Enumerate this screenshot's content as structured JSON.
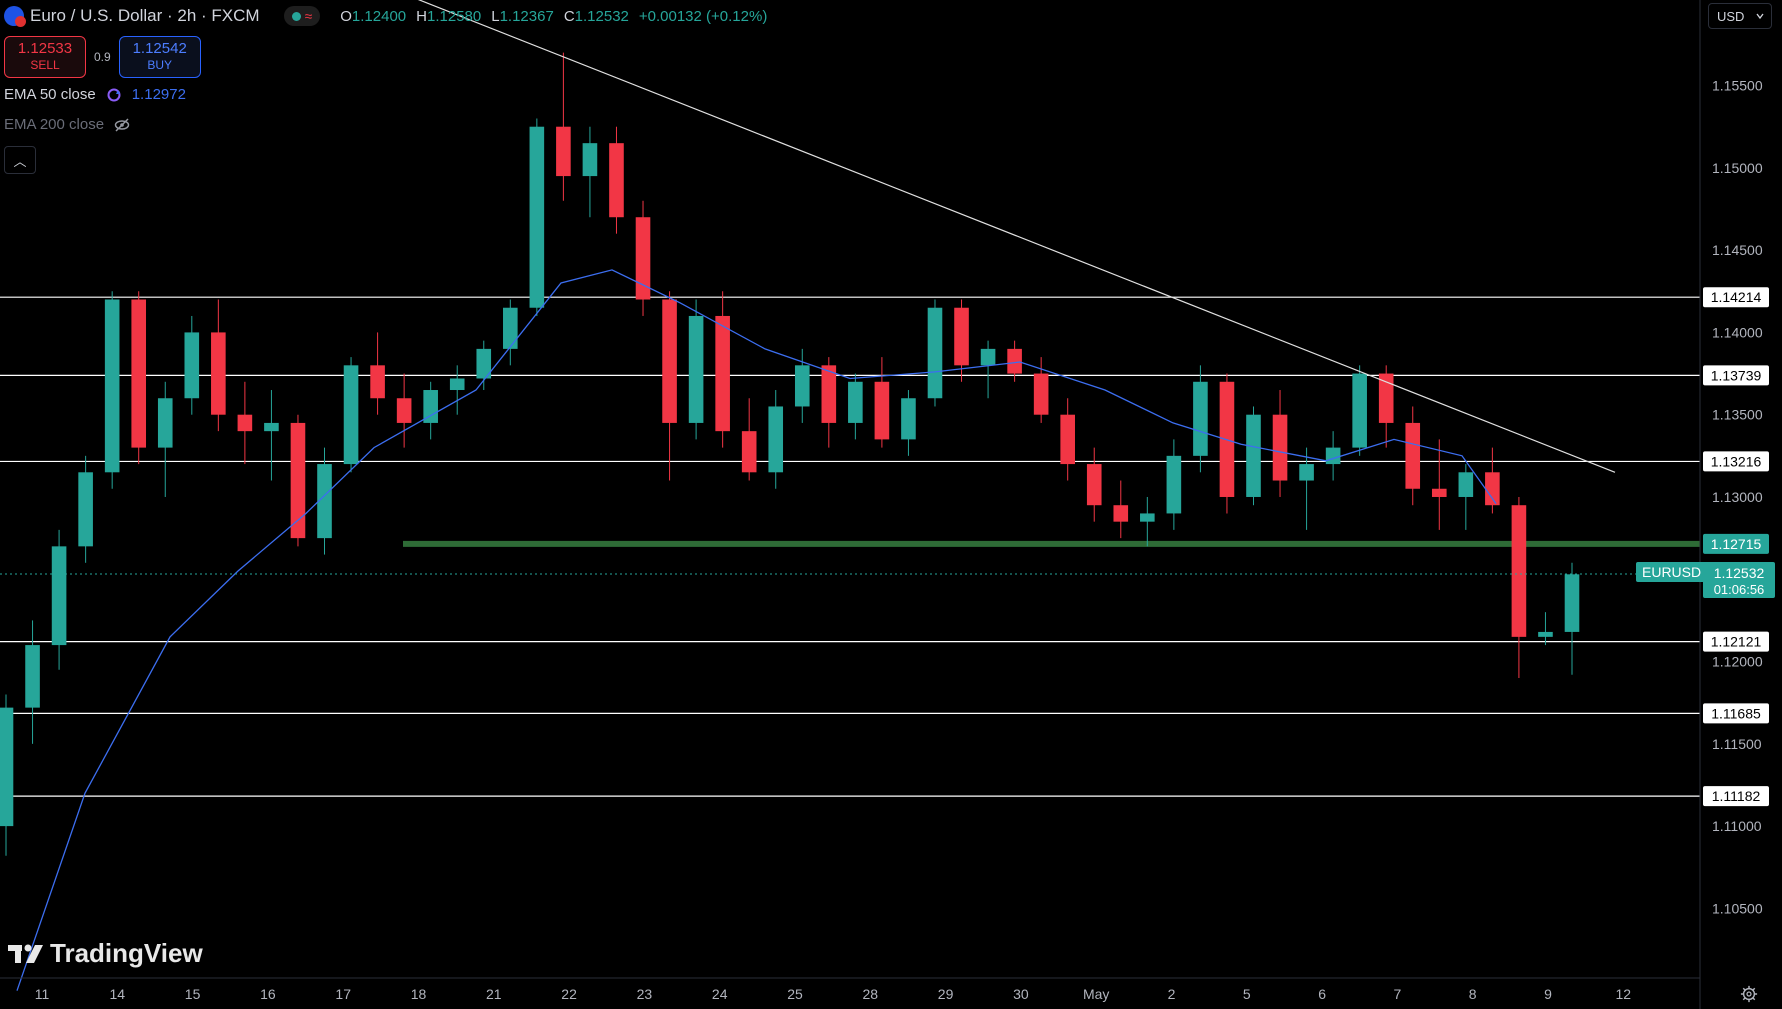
{
  "header": {
    "symbol_title": "Euro / U.S. Dollar · 2h · FXCM",
    "ohlc": {
      "o_label": "O",
      "o": "1.12400",
      "h_label": "H",
      "h": "1.12580",
      "l_label": "L",
      "l": "1.12367",
      "c_label": "C",
      "c": "1.12532",
      "change": "+0.00132 (+0.12%)"
    }
  },
  "trade": {
    "sell_price": "1.12533",
    "sell_label": "SELL",
    "spread": "0.9",
    "buy_price": "1.12542",
    "buy_label": "BUY"
  },
  "indicators": [
    {
      "label": "EMA 50 close",
      "value": "1.12972",
      "color": "#3c6ef0",
      "visible": true
    },
    {
      "label": "EMA 200 close",
      "visible": false
    }
  ],
  "currency": "USD",
  "brand": "TradingView",
  "icons": [
    "refresh-icon",
    "eye-off-icon",
    "chevron-up-icon",
    "chevron-down-icon",
    "gear-icon",
    "flag-icon"
  ],
  "colors": {
    "background": "#000000",
    "up": "#26a69a",
    "down": "#f23645",
    "ema": "#3c6ef0",
    "level": "#ffffff",
    "zone": "#2e6b36"
  },
  "chart_data": {
    "type": "candlestick",
    "x_tick_labels": [
      "11",
      "14",
      "15",
      "16",
      "17",
      "18",
      "21",
      "22",
      "23",
      "24",
      "25",
      "28",
      "29",
      "30",
      "May",
      "2",
      "5",
      "6",
      "7",
      "8",
      "9",
      "12"
    ],
    "y_tick_labels": [
      "1.10500",
      "1.11000",
      "1.11500",
      "1.12000",
      "1.12500",
      "1.13000",
      "1.13500",
      "1.14000",
      "1.14500",
      "1.15000",
      "1.15500"
    ],
    "y_range": [
      1.10077,
      1.1602
    ],
    "horizontal_levels": [
      "1.14214",
      "1.13739",
      "1.13216",
      "1.12121",
      "1.11685",
      "1.11182"
    ],
    "support_zone": "1.12715",
    "trendline": {
      "from": [
        0.21,
        1.1617
      ],
      "to": [
        0.95,
        1.1315
      ]
    },
    "last_price": {
      "symbol": "EURUSD",
      "price": "1.12532",
      "countdown": "01:06:56"
    },
    "ema50_key": [
      [
        0.01,
        1.1
      ],
      [
        0.05,
        1.112
      ],
      [
        0.1,
        1.1215
      ],
      [
        0.14,
        1.1255
      ],
      [
        0.18,
        1.129
      ],
      [
        0.22,
        1.133
      ],
      [
        0.28,
        1.1365
      ],
      [
        0.33,
        1.143
      ],
      [
        0.36,
        1.1438
      ],
      [
        0.4,
        1.1418
      ],
      [
        0.45,
        1.139
      ],
      [
        0.5,
        1.1372
      ],
      [
        0.55,
        1.1376
      ],
      [
        0.6,
        1.1382
      ],
      [
        0.65,
        1.1365
      ],
      [
        0.69,
        1.1345
      ],
      [
        0.73,
        1.1332
      ],
      [
        0.78,
        1.1322
      ],
      [
        0.82,
        1.1335
      ],
      [
        0.86,
        1.1325
      ],
      [
        0.88,
        1.1296
      ]
    ],
    "candles_ohlc": [
      [
        1.11,
        1.118,
        1.1082,
        1.1172
      ],
      [
        1.1172,
        1.1225,
        1.115,
        1.121
      ],
      [
        1.121,
        1.128,
        1.1195,
        1.127
      ],
      [
        1.127,
        1.1325,
        1.126,
        1.1315
      ],
      [
        1.1315,
        1.1425,
        1.1305,
        1.142
      ],
      [
        1.142,
        1.1425,
        1.132,
        1.133
      ],
      [
        1.133,
        1.137,
        1.13,
        1.136
      ],
      [
        1.136,
        1.141,
        1.135,
        1.14
      ],
      [
        1.14,
        1.142,
        1.134,
        1.135
      ],
      [
        1.135,
        1.137,
        1.132,
        1.134
      ],
      [
        1.134,
        1.1365,
        1.131,
        1.1345
      ],
      [
        1.1345,
        1.135,
        1.127,
        1.1275
      ],
      [
        1.1275,
        1.133,
        1.1265,
        1.132
      ],
      [
        1.132,
        1.1385,
        1.1315,
        1.138
      ],
      [
        1.138,
        1.14,
        1.135,
        1.136
      ],
      [
        1.136,
        1.1375,
        1.133,
        1.1345
      ],
      [
        1.1345,
        1.137,
        1.1335,
        1.1365
      ],
      [
        1.1365,
        1.138,
        1.135,
        1.1372
      ],
      [
        1.1372,
        1.1395,
        1.1365,
        1.139
      ],
      [
        1.139,
        1.142,
        1.138,
        1.1415
      ],
      [
        1.1415,
        1.153,
        1.141,
        1.1525
      ],
      [
        1.1525,
        1.157,
        1.148,
        1.1495
      ],
      [
        1.1495,
        1.1525,
        1.147,
        1.1515
      ],
      [
        1.1515,
        1.1525,
        1.146,
        1.147
      ],
      [
        1.147,
        1.148,
        1.141,
        1.142
      ],
      [
        1.142,
        1.1425,
        1.131,
        1.1345
      ],
      [
        1.1345,
        1.142,
        1.1335,
        1.141
      ],
      [
        1.141,
        1.1425,
        1.133,
        1.134
      ],
      [
        1.134,
        1.136,
        1.131,
        1.1315
      ],
      [
        1.1315,
        1.1365,
        1.1305,
        1.1355
      ],
      [
        1.1355,
        1.139,
        1.1345,
        1.138
      ],
      [
        1.138,
        1.1385,
        1.133,
        1.1345
      ],
      [
        1.1345,
        1.1375,
        1.1335,
        1.137
      ],
      [
        1.137,
        1.1385,
        1.133,
        1.1335
      ],
      [
        1.1335,
        1.1365,
        1.1325,
        1.136
      ],
      [
        1.136,
        1.142,
        1.1355,
        1.1415
      ],
      [
        1.1415,
        1.142,
        1.137,
        1.138
      ],
      [
        1.138,
        1.1395,
        1.136,
        1.139
      ],
      [
        1.139,
        1.1395,
        1.137,
        1.1375
      ],
      [
        1.1375,
        1.1385,
        1.1345,
        1.135
      ],
      [
        1.135,
        1.136,
        1.131,
        1.132
      ],
      [
        1.132,
        1.133,
        1.1285,
        1.1295
      ],
      [
        1.1295,
        1.131,
        1.1275,
        1.1285
      ],
      [
        1.1285,
        1.13,
        1.127,
        1.129
      ],
      [
        1.129,
        1.1335,
        1.128,
        1.1325
      ],
      [
        1.1325,
        1.138,
        1.1315,
        1.137
      ],
      [
        1.137,
        1.1375,
        1.129,
        1.13
      ],
      [
        1.13,
        1.1355,
        1.1295,
        1.135
      ],
      [
        1.135,
        1.1365,
        1.13,
        1.131
      ],
      [
        1.131,
        1.133,
        1.128,
        1.132
      ],
      [
        1.132,
        1.134,
        1.131,
        1.133
      ],
      [
        1.133,
        1.138,
        1.1325,
        1.1375
      ],
      [
        1.1375,
        1.138,
        1.133,
        1.1345
      ],
      [
        1.1345,
        1.1355,
        1.1295,
        1.1305
      ],
      [
        1.1305,
        1.1335,
        1.128,
        1.13
      ],
      [
        1.13,
        1.132,
        1.128,
        1.1315
      ],
      [
        1.1315,
        1.133,
        1.129,
        1.1295
      ],
      [
        1.1295,
        1.13,
        1.119,
        1.1215
      ],
      [
        1.1215,
        1.123,
        1.121,
        1.1218
      ],
      [
        1.1218,
        1.126,
        1.1192,
        1.1253
      ]
    ]
  }
}
